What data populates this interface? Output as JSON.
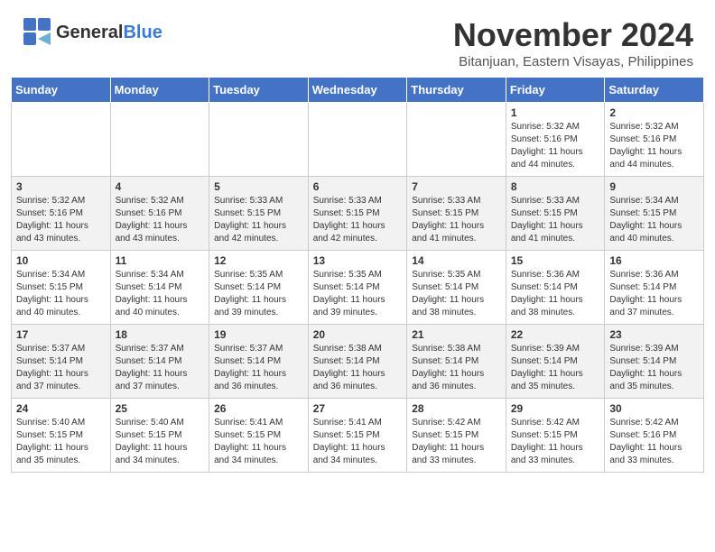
{
  "header": {
    "logo_general": "General",
    "logo_blue": "Blue",
    "month_title": "November 2024",
    "subtitle": "Bitanjuan, Eastern Visayas, Philippines"
  },
  "days_of_week": [
    "Sunday",
    "Monday",
    "Tuesday",
    "Wednesday",
    "Thursday",
    "Friday",
    "Saturday"
  ],
  "weeks": [
    [
      {
        "day": "",
        "info": ""
      },
      {
        "day": "",
        "info": ""
      },
      {
        "day": "",
        "info": ""
      },
      {
        "day": "",
        "info": ""
      },
      {
        "day": "",
        "info": ""
      },
      {
        "day": "1",
        "info": "Sunrise: 5:32 AM\nSunset: 5:16 PM\nDaylight: 11 hours\nand 44 minutes."
      },
      {
        "day": "2",
        "info": "Sunrise: 5:32 AM\nSunset: 5:16 PM\nDaylight: 11 hours\nand 44 minutes."
      }
    ],
    [
      {
        "day": "3",
        "info": "Sunrise: 5:32 AM\nSunset: 5:16 PM\nDaylight: 11 hours\nand 43 minutes."
      },
      {
        "day": "4",
        "info": "Sunrise: 5:32 AM\nSunset: 5:16 PM\nDaylight: 11 hours\nand 43 minutes."
      },
      {
        "day": "5",
        "info": "Sunrise: 5:33 AM\nSunset: 5:15 PM\nDaylight: 11 hours\nand 42 minutes."
      },
      {
        "day": "6",
        "info": "Sunrise: 5:33 AM\nSunset: 5:15 PM\nDaylight: 11 hours\nand 42 minutes."
      },
      {
        "day": "7",
        "info": "Sunrise: 5:33 AM\nSunset: 5:15 PM\nDaylight: 11 hours\nand 41 minutes."
      },
      {
        "day": "8",
        "info": "Sunrise: 5:33 AM\nSunset: 5:15 PM\nDaylight: 11 hours\nand 41 minutes."
      },
      {
        "day": "9",
        "info": "Sunrise: 5:34 AM\nSunset: 5:15 PM\nDaylight: 11 hours\nand 40 minutes."
      }
    ],
    [
      {
        "day": "10",
        "info": "Sunrise: 5:34 AM\nSunset: 5:15 PM\nDaylight: 11 hours\nand 40 minutes."
      },
      {
        "day": "11",
        "info": "Sunrise: 5:34 AM\nSunset: 5:14 PM\nDaylight: 11 hours\nand 40 minutes."
      },
      {
        "day": "12",
        "info": "Sunrise: 5:35 AM\nSunset: 5:14 PM\nDaylight: 11 hours\nand 39 minutes."
      },
      {
        "day": "13",
        "info": "Sunrise: 5:35 AM\nSunset: 5:14 PM\nDaylight: 11 hours\nand 39 minutes."
      },
      {
        "day": "14",
        "info": "Sunrise: 5:35 AM\nSunset: 5:14 PM\nDaylight: 11 hours\nand 38 minutes."
      },
      {
        "day": "15",
        "info": "Sunrise: 5:36 AM\nSunset: 5:14 PM\nDaylight: 11 hours\nand 38 minutes."
      },
      {
        "day": "16",
        "info": "Sunrise: 5:36 AM\nSunset: 5:14 PM\nDaylight: 11 hours\nand 37 minutes."
      }
    ],
    [
      {
        "day": "17",
        "info": "Sunrise: 5:37 AM\nSunset: 5:14 PM\nDaylight: 11 hours\nand 37 minutes."
      },
      {
        "day": "18",
        "info": "Sunrise: 5:37 AM\nSunset: 5:14 PM\nDaylight: 11 hours\nand 37 minutes."
      },
      {
        "day": "19",
        "info": "Sunrise: 5:37 AM\nSunset: 5:14 PM\nDaylight: 11 hours\nand 36 minutes."
      },
      {
        "day": "20",
        "info": "Sunrise: 5:38 AM\nSunset: 5:14 PM\nDaylight: 11 hours\nand 36 minutes."
      },
      {
        "day": "21",
        "info": "Sunrise: 5:38 AM\nSunset: 5:14 PM\nDaylight: 11 hours\nand 36 minutes."
      },
      {
        "day": "22",
        "info": "Sunrise: 5:39 AM\nSunset: 5:14 PM\nDaylight: 11 hours\nand 35 minutes."
      },
      {
        "day": "23",
        "info": "Sunrise: 5:39 AM\nSunset: 5:14 PM\nDaylight: 11 hours\nand 35 minutes."
      }
    ],
    [
      {
        "day": "24",
        "info": "Sunrise: 5:40 AM\nSunset: 5:15 PM\nDaylight: 11 hours\nand 35 minutes."
      },
      {
        "day": "25",
        "info": "Sunrise: 5:40 AM\nSunset: 5:15 PM\nDaylight: 11 hours\nand 34 minutes."
      },
      {
        "day": "26",
        "info": "Sunrise: 5:41 AM\nSunset: 5:15 PM\nDaylight: 11 hours\nand 34 minutes."
      },
      {
        "day": "27",
        "info": "Sunrise: 5:41 AM\nSunset: 5:15 PM\nDaylight: 11 hours\nand 34 minutes."
      },
      {
        "day": "28",
        "info": "Sunrise: 5:42 AM\nSunset: 5:15 PM\nDaylight: 11 hours\nand 33 minutes."
      },
      {
        "day": "29",
        "info": "Sunrise: 5:42 AM\nSunset: 5:15 PM\nDaylight: 11 hours\nand 33 minutes."
      },
      {
        "day": "30",
        "info": "Sunrise: 5:42 AM\nSunset: 5:16 PM\nDaylight: 11 hours\nand 33 minutes."
      }
    ]
  ]
}
